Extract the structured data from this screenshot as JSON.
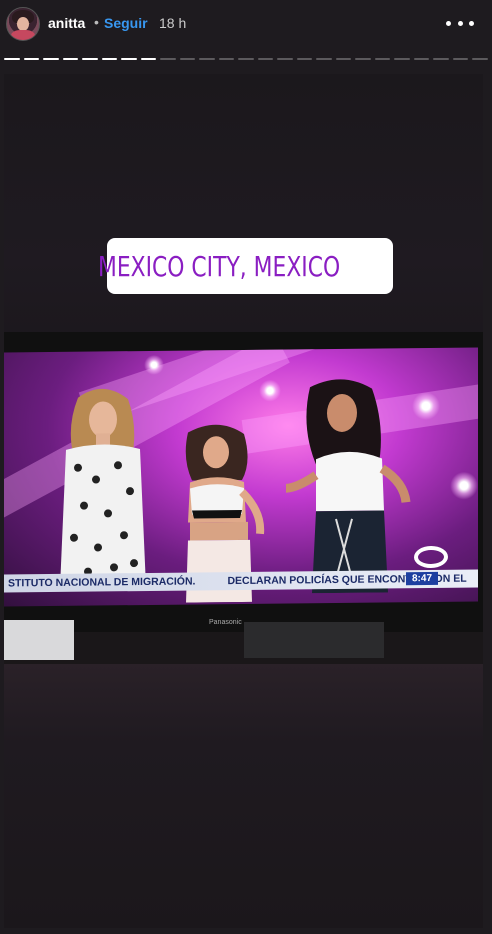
{
  "header": {
    "username": "anitta",
    "separator": "•",
    "follow_label": "Seguir",
    "time_ago": "18 h",
    "more_icon": "more-horizontal-icon"
  },
  "progress": {
    "total_segments": 25,
    "completed_segments": 8
  },
  "story": {
    "location_sticker": {
      "icon": "location-pin-icon",
      "text": "MEXICO CITY, MEXICO",
      "color": "#8a1ec2"
    },
    "tv": {
      "ticker_left": "STITUTO NACIONAL DE MIGRACIÓN.",
      "ticker_right": "DECLARAN POLICÍAS QUE ENCONTRARON EL",
      "clock": "8:47",
      "brand": "Panasonic"
    }
  },
  "colors": {
    "background": "#1e1b1f",
    "follow": "#3897f0",
    "progress_done": "#ffffff",
    "progress_pending": "#5c5a5d"
  }
}
